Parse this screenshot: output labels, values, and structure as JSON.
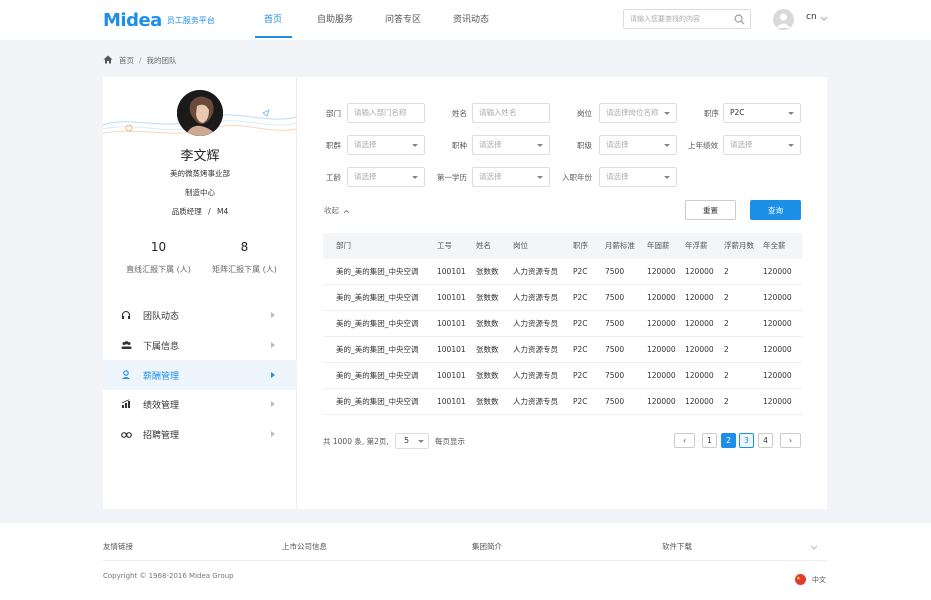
{
  "header": {
    "logo_text": "Midea",
    "logo_sub": "员工服务平台",
    "nav": [
      "首页",
      "自助服务",
      "问答专区",
      "资讯动态"
    ],
    "search_placeholder": "请输入您要查找的内容",
    "lang": "cn"
  },
  "breadcrumb": [
    "首页",
    "我的团队"
  ],
  "profile": {
    "name": "李文辉",
    "dept": "美的微蒸烤事业部",
    "center": "制造中心",
    "title": "品质经理",
    "level": "M4",
    "title_sep": "/",
    "direct_count": "10",
    "direct_label": "直线汇报下属 (人)",
    "matrix_count": "8",
    "matrix_label": "矩阵汇报下属 (人)"
  },
  "menu": [
    {
      "label": "团队动态",
      "icon": "headset-icon"
    },
    {
      "label": "下属信息",
      "icon": "people-icon"
    },
    {
      "label": "薪酬管理",
      "icon": "salary-icon"
    },
    {
      "label": "绩效管理",
      "icon": "chart-icon"
    },
    {
      "label": "招聘管理",
      "icon": "binoculars-icon"
    }
  ],
  "active_menu": "薪酬管理",
  "filters": {
    "dept": {
      "label": "部门",
      "placeholder": "请输入部门名称"
    },
    "name": {
      "label": "姓名",
      "placeholder": "请输入姓名"
    },
    "post": {
      "label": "岗位",
      "placeholder": "请选择岗位名称"
    },
    "seq": {
      "label": "职序",
      "value": "P2C"
    },
    "group": {
      "label": "职群",
      "placeholder": "请选择"
    },
    "kind": {
      "label": "职种",
      "placeholder": "请选择"
    },
    "grade": {
      "label": "职级",
      "placeholder": "请选择"
    },
    "perf": {
      "label": "上年绩效",
      "placeholder": "请选择"
    },
    "age": {
      "label": "工龄",
      "placeholder": "请选择"
    },
    "edu": {
      "label": "第一学历",
      "placeholder": "请选择"
    },
    "year": {
      "label": "入职年份",
      "placeholder": "请选择"
    }
  },
  "collapse_label": "收起",
  "buttons": {
    "reset": "重置",
    "query": "查询"
  },
  "table": {
    "headers": [
      "部门",
      "工号",
      "姓名",
      "岗位",
      "职序",
      "月薪标准",
      "年固薪",
      "年浮薪",
      "浮薪月数",
      "年全薪"
    ],
    "rows": [
      [
        "美的_美的集团_中央空调",
        "100101",
        "张数数",
        "人力资源专员",
        "P2C",
        "7500",
        "120000",
        "120000",
        "2",
        "120000"
      ],
      [
        "美的_美的集团_中央空调",
        "100101",
        "张数数",
        "人力资源专员",
        "P2C",
        "7500",
        "120000",
        "120000",
        "2",
        "120000"
      ],
      [
        "美的_美的集团_中央空调",
        "100101",
        "张数数",
        "人力资源专员",
        "P2C",
        "7500",
        "120000",
        "120000",
        "2",
        "120000"
      ],
      [
        "美的_美的集团_中央空调",
        "100101",
        "张数数",
        "人力资源专员",
        "P2C",
        "7500",
        "120000",
        "120000",
        "2",
        "120000"
      ],
      [
        "美的_美的集团_中央空调",
        "100101",
        "张数数",
        "人力资源专员",
        "P2C",
        "7500",
        "120000",
        "120000",
        "2",
        "120000"
      ],
      [
        "美的_美的集团_中央空调",
        "100101",
        "张数数",
        "人力资源专员",
        "P2C",
        "7500",
        "120000",
        "120000",
        "2",
        "120000"
      ]
    ]
  },
  "pagination": {
    "info": "共 1000 条, 第2页,",
    "page_size": "5",
    "per_page_label": "每页显示",
    "prev": "‹",
    "next": "›",
    "pages": [
      "1",
      "2",
      "3",
      "4"
    ],
    "current": "2"
  },
  "footer": {
    "links": [
      "友情链接",
      "上市公司信息",
      "集团简介",
      "软件下载"
    ],
    "copyright": "Copyright © 1968-2016 Midea Group",
    "lang": "中文"
  },
  "colors": {
    "accent": "#1e8fe6",
    "background": "#f3f4f7"
  }
}
